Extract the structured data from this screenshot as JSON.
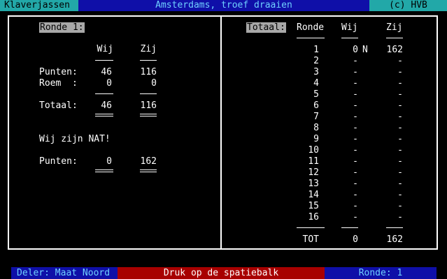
{
  "title_bar": {
    "app_name": "Klaverjassen",
    "variant": "Amsterdams, troef draaien",
    "copyright": "(c) HVB"
  },
  "left_panel": {
    "round_label": "Ronde 1:",
    "col_wij": "Wij",
    "col_zij": "Zij",
    "points_label": "Punten:",
    "points_wij": "46",
    "points_zij": "116",
    "roem_label": "Roem  :",
    "roem_wij": "0",
    "roem_zij": "0",
    "total_label": "Totaal:",
    "total_wij": "46",
    "total_zij": "116",
    "message": "Wij zijn NAT!",
    "final_label": "Punten:",
    "final_wij": "0",
    "final_zij": "162"
  },
  "right_panel": {
    "total_label": "Totaal:",
    "col_ronde": "Ronde",
    "col_wij": "Wij",
    "col_zij": "Zij",
    "rows": [
      {
        "ronde": "1",
        "wij": "0",
        "mark": "N",
        "zij": "162"
      },
      {
        "ronde": "2",
        "wij": "-",
        "mark": "",
        "zij": "-"
      },
      {
        "ronde": "3",
        "wij": "-",
        "mark": "",
        "zij": "-"
      },
      {
        "ronde": "4",
        "wij": "-",
        "mark": "",
        "zij": "-"
      },
      {
        "ronde": "5",
        "wij": "-",
        "mark": "",
        "zij": "-"
      },
      {
        "ronde": "6",
        "wij": "-",
        "mark": "",
        "zij": "-"
      },
      {
        "ronde": "7",
        "wij": "-",
        "mark": "",
        "zij": "-"
      },
      {
        "ronde": "8",
        "wij": "-",
        "mark": "",
        "zij": "-"
      },
      {
        "ronde": "9",
        "wij": "-",
        "mark": "",
        "zij": "-"
      },
      {
        "ronde": "10",
        "wij": "-",
        "mark": "",
        "zij": "-"
      },
      {
        "ronde": "11",
        "wij": "-",
        "mark": "",
        "zij": "-"
      },
      {
        "ronde": "12",
        "wij": "-",
        "mark": "",
        "zij": "-"
      },
      {
        "ronde": "13",
        "wij": "-",
        "mark": "",
        "zij": "-"
      },
      {
        "ronde": "14",
        "wij": "-",
        "mark": "",
        "zij": "-"
      },
      {
        "ronde": "15",
        "wij": "-",
        "mark": "",
        "zij": "-"
      },
      {
        "ronde": "16",
        "wij": "-",
        "mark": "",
        "zij": "-"
      }
    ],
    "tot_label": "TOT",
    "tot_wij": "0",
    "tot_zij": "162"
  },
  "status_bar": {
    "dealer": "Deler: Maat Noord",
    "prompt": "Druk op de spatiebalk",
    "round": "Ronde: 1"
  }
}
